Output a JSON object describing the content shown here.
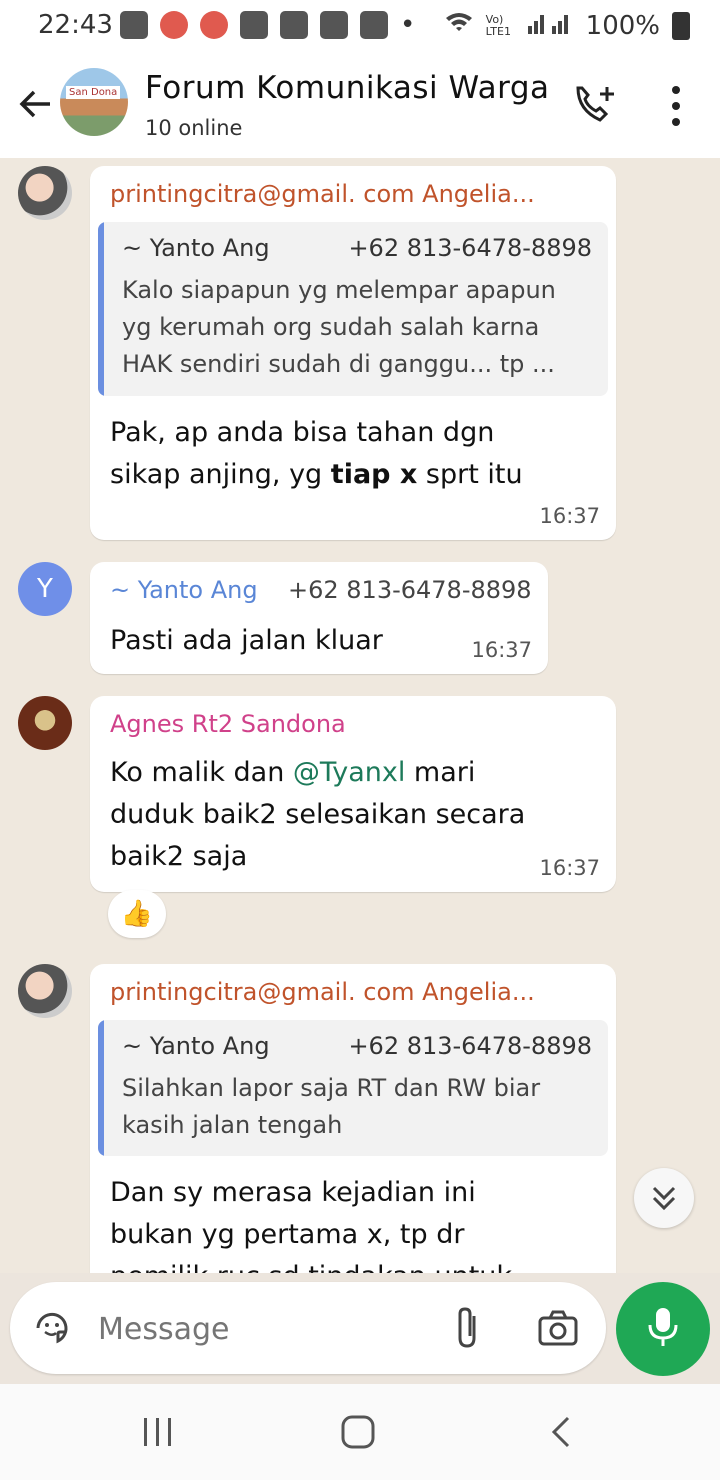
{
  "status_bar": {
    "time": "22:43",
    "network": "Vo) LTE1",
    "battery": "100%"
  },
  "header": {
    "title": "Forum Komunikasi Warga",
    "subtitle": "10 online",
    "avatar_sign": "San Dona"
  },
  "messages": [
    {
      "sender": "printingcitra@gmail. com Angelia...",
      "sender_color": "#c0532b",
      "quote": {
        "name": "~ Yanto Ang",
        "phone": "+62 813-6478-8898",
        "text": "Kalo siapapun yg melempar apapun yg kerumah org sudah salah karna HAK sendiri sudah di ganggu... tp ..."
      },
      "body_line1": "Pak, ap anda bisa tahan dgn",
      "body_line2_pre": "sikap anjing, yg ",
      "body_line2_bold": "tiap x",
      "body_line2_post": " sprt itu",
      "time": "16:37"
    },
    {
      "sender_name": "~ Yanto Ang",
      "sender_phone": "+62 813-6478-8898",
      "avatar_letter": "Y",
      "body": "Pasti ada jalan kluar",
      "time": "16:37"
    },
    {
      "sender": "Agnes Rt2 Sandona",
      "sender_color": "#d0418a",
      "body_pre": "Ko malik dan ",
      "mention": "@Tyanxl",
      "body_line1_post": " mari",
      "body_line2": "duduk baik2 selesaikan secara",
      "body_line3": "baik2 saja",
      "time": "16:37",
      "reaction": "👍"
    },
    {
      "sender": "printingcitra@gmail. com Angelia...",
      "quote": {
        "name": "~ Yanto Ang",
        "phone": "+62 813-6478-8898",
        "text": "Silahkan lapor saja RT dan RW biar kasih jalan tengah"
      },
      "body_line1": "Dan sy merasa kejadian ini",
      "body_line2": "bukan yg pertama x, tp dr",
      "body_line3": "pemilik ruc sd tindakan untuk"
    }
  ],
  "composer": {
    "placeholder": "Message"
  }
}
